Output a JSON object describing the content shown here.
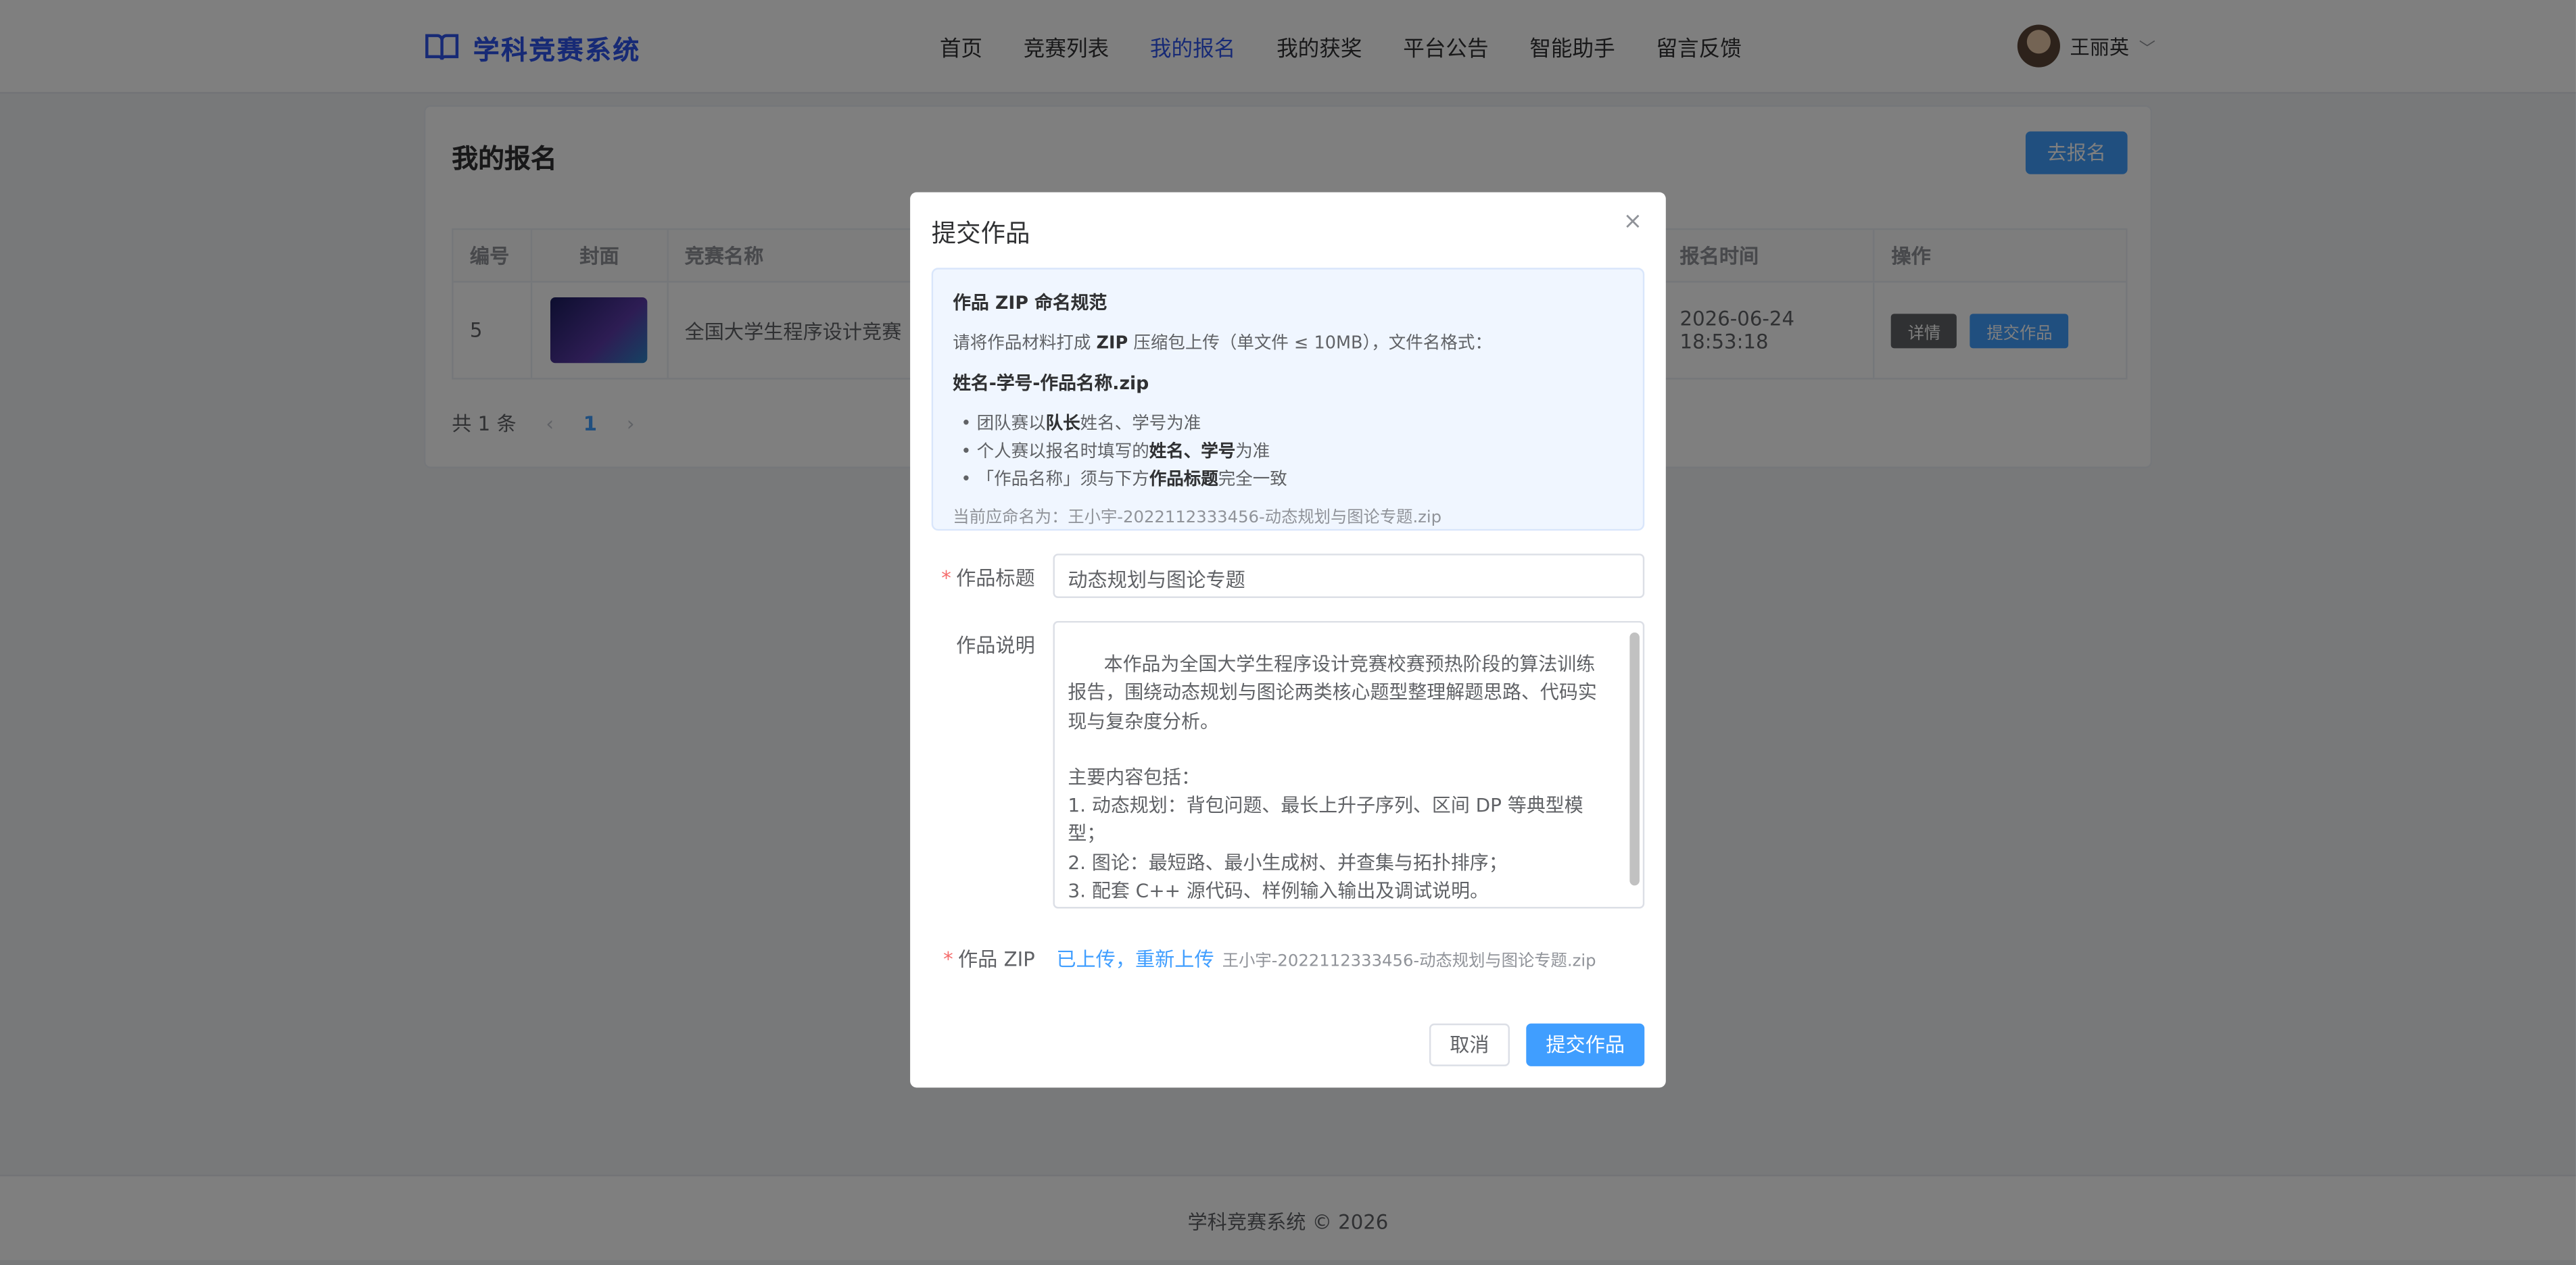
{
  "header": {
    "brand": "学科竞赛系统",
    "nav": [
      "首页",
      "竞赛列表",
      "我的报名",
      "我的获奖",
      "平台公告",
      "智能助手",
      "留言反馈"
    ],
    "active_nav": "我的报名",
    "user_name": "王丽英"
  },
  "page": {
    "title": "我的报名",
    "go_button": "去报名",
    "table": {
      "columns": [
        "编号",
        "封面",
        "竞赛名称",
        "报名时间",
        "操作"
      ],
      "rows": [
        {
          "id": "5",
          "name": "全国大学生程序设计竞赛",
          "time": "2026-06-24 18:53:18",
          "actions": [
            "详情",
            "提交作品"
          ]
        }
      ]
    },
    "pagination": {
      "total": "共 1 条",
      "prev": "‹",
      "current": "1",
      "next": "›"
    }
  },
  "footer": {
    "text": "学科竞赛系统 © 2026"
  },
  "dialog": {
    "title": "提交作品",
    "close": "×",
    "notice": {
      "title": "作品 ZIP 命名规范",
      "intro_a": "请将作品材料打成 ",
      "intro_b": "ZIP",
      "intro_c": " 压缩包上传（单文件 ≤ 10MB），文件名格式：",
      "format": "姓名-学号-作品名称.zip",
      "rules": [
        [
          "团队赛以",
          "队长",
          "姓名、学号为准"
        ],
        [
          "个人赛以报名时填写的",
          "姓名、学号",
          "为准"
        ],
        [
          "「作品名称」须与下方",
          "作品标题",
          "完全一致"
        ]
      ],
      "current": "当前应命名为：王小宇-2022112333456-动态规划与图论专题.zip"
    },
    "form": {
      "title_label": "作品标题",
      "title_value": "动态规划与图论专题",
      "desc_label": "作品说明",
      "desc_value": "本作品为全国大学生程序设计竞赛校赛预热阶段的算法训练报告，围绕动态规划与图论两类核心题型整理解题思路、代码实现与复杂度分析。\n\n主要内容包括：\n1. 动态规划：背包问题、最长上升子序列、区间 DP 等典型模型；\n2. 图论：最短路、最小生成树、并查集与拓扑排序；\n3. 配套 C++ 源代码、样例输入输出及调试说明。",
      "zip_label": "作品 ZIP",
      "zip_status": "已上传，重新上传",
      "zip_file": "王小宇-2022112333456-动态规划与图论专题.zip"
    },
    "buttons": {
      "cancel": "取消",
      "submit": "提交作品"
    }
  },
  "colors": {
    "brand": "#2f54eb",
    "primary": "#409eff",
    "required": "#f56c6c"
  }
}
